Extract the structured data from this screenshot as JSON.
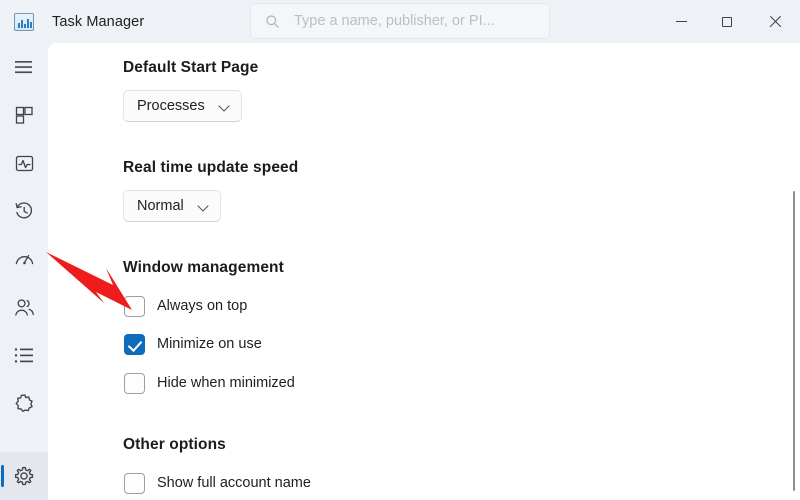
{
  "window": {
    "title": "Task Manager",
    "app_icon": "task-manager-chart-icon",
    "controls": {
      "minimize": "minimize-icon",
      "maximize": "maximize-icon",
      "close": "close-icon"
    }
  },
  "search": {
    "icon": "search-icon",
    "placeholder": "Type a name, publisher, or PI...",
    "value": ""
  },
  "sidebar": {
    "items": [
      {
        "name": "hamburger-menu",
        "icon": "hamburger-icon",
        "selected": false
      },
      {
        "name": "processes",
        "icon": "processes-grid-icon",
        "selected": false
      },
      {
        "name": "performance",
        "icon": "performance-pulse-icon",
        "selected": false
      },
      {
        "name": "app-history",
        "icon": "history-clock-icon",
        "selected": false
      },
      {
        "name": "startup-apps",
        "icon": "speedometer-icon",
        "selected": false
      },
      {
        "name": "users",
        "icon": "users-people-icon",
        "selected": false
      },
      {
        "name": "details",
        "icon": "list-details-icon",
        "selected": false
      },
      {
        "name": "services",
        "icon": "services-puzzle-icon",
        "selected": false
      },
      {
        "name": "settings",
        "icon": "gear-icon",
        "selected": true
      }
    ]
  },
  "main": {
    "sections": [
      {
        "title": "Default Start Page",
        "control": "dropdown",
        "selected": "Processes"
      },
      {
        "title": "Real time update speed",
        "control": "dropdown",
        "selected": "Normal"
      },
      {
        "title": "Window management",
        "control": "checkboxes",
        "checkboxes": [
          {
            "label": "Always on top",
            "checked": false
          },
          {
            "label": "Minimize on use",
            "checked": true
          },
          {
            "label": "Hide when minimized",
            "checked": false
          }
        ]
      },
      {
        "title": "Other options",
        "control": "checkboxes",
        "checkboxes": [
          {
            "label": "Show full account name",
            "checked": false
          }
        ]
      }
    ]
  },
  "annotation": {
    "type": "arrow",
    "color": "#ee1c1c",
    "points_to": "Always on top checkbox"
  },
  "colors": {
    "accent": "#0f6cbd",
    "chrome": "#eef1f5",
    "content": "#ffffff",
    "annotation_red": "#ee1c1c"
  }
}
